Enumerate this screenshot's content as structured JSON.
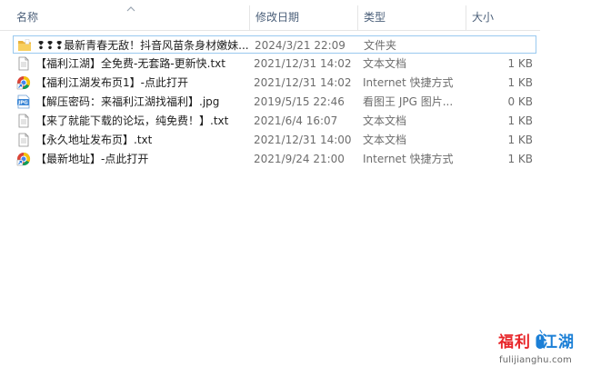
{
  "columns": {
    "name": "名称",
    "date": "修改日期",
    "type": "类型",
    "size": "大小"
  },
  "files": [
    {
      "icon": "folder-icon",
      "name": "❢❢❢最新青春无敌！抖音风苗条身材嫩妹...",
      "date": "2024/3/21 22:09",
      "type": "文件夹",
      "size": ""
    },
    {
      "icon": "text-file-icon",
      "name": "【福利江湖】全免费-无套路-更新快.txt",
      "date": "2021/12/31 14:02",
      "type": "文本文档",
      "size": "1 KB"
    },
    {
      "icon": "internet-shortcut-icon",
      "name": "【福利江湖发布页1】-点此打开",
      "date": "2021/12/31 14:02",
      "type": "Internet 快捷方式",
      "size": "1 KB"
    },
    {
      "icon": "jpg-image-icon",
      "name": "【解压密码：来福利江湖找福利】.jpg",
      "date": "2019/5/15 22:46",
      "type": "看图王 JPG 图片...",
      "size": "0 KB"
    },
    {
      "icon": "text-file-icon",
      "name": "【来了就能下载的论坛，纯免费！】.txt",
      "date": "2021/6/4 16:07",
      "type": "文本文档",
      "size": "1 KB"
    },
    {
      "icon": "text-file-icon",
      "name": "【永久地址发布页】.txt",
      "date": "2021/12/31 14:00",
      "type": "文本文档",
      "size": "1 KB"
    },
    {
      "icon": "internet-shortcut-icon",
      "name": "【最新地址】-点此打开",
      "date": "2021/9/24 21:00",
      "type": "Internet 快捷方式",
      "size": "1 KB"
    }
  ],
  "watermark": {
    "part1": "福利",
    "part2": "江湖",
    "url": "fulijianghu.com"
  },
  "colors": {
    "selection_border": "#99c9ef",
    "header_text": "#4c607a",
    "folder": "#f5c24c",
    "watermark_red": "#e8262a",
    "watermark_blue": "#1b7fd6"
  }
}
